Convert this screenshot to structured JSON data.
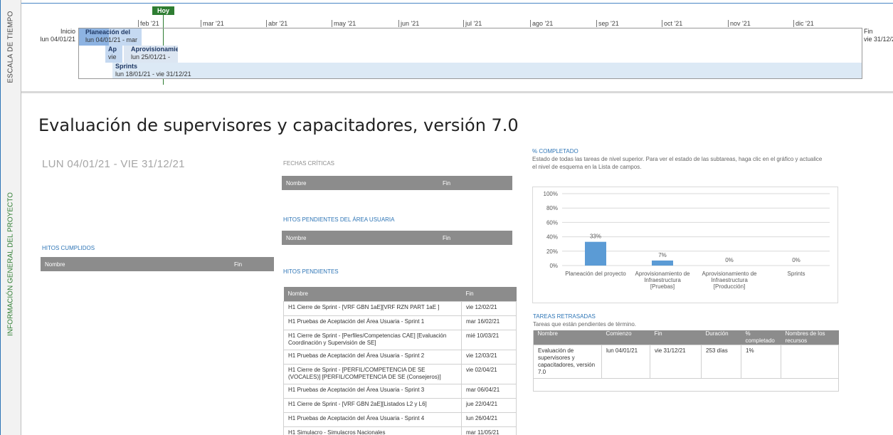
{
  "timeline": {
    "side_label": "ESCALA DE TIEMPO",
    "today_label": "Hoy",
    "months": [
      "feb '21",
      "mar '21",
      "abr '21",
      "may '21",
      "jun '21",
      "jul '21",
      "ago '21",
      "sep '21",
      "oct '21",
      "nov '21",
      "dic '21"
    ],
    "start": {
      "label": "Inicio",
      "date": "lun 04/01/21"
    },
    "end": {
      "label": "Fin",
      "date": "vie 31/12/2"
    },
    "tasks": [
      {
        "name": "Planeación del",
        "dates": "lun 04/01/21 - mar"
      },
      {
        "name": "Ap",
        "dates": "vie"
      },
      {
        "name": "Aprovisionamie",
        "dates": "lun 25/01/21 -"
      },
      {
        "name": "Sprints",
        "dates": "lun 18/01/21 - vie 31/12/21"
      }
    ]
  },
  "overview": {
    "side_label": "INFORMACIÓN GENERAL DEL PROYECTO",
    "title": "Evaluación de supervisores y capacitadores, versión 7.0",
    "date_range": "LUN 04/01/21 -  VIE 31/12/21"
  },
  "fechas_criticas": {
    "heading": "FECHAS CRÍTICAS",
    "columns": [
      "Nombre",
      "Fin"
    ]
  },
  "hitos_area_usuaria": {
    "heading": "HITOS PENDIENTES DEL ÁREA USUARIA",
    "columns": [
      "Nombre",
      "Fin"
    ]
  },
  "hitos_cumplidos": {
    "heading": "HITOS CUMPLIDOS",
    "columns": [
      "Nombre",
      "Fin"
    ]
  },
  "hitos_pendientes": {
    "heading": "HITOS PENDIENTES",
    "columns": [
      "Nombre",
      "Fin"
    ],
    "rows": [
      {
        "nombre": "H1 Cierre de Sprint - [VRF GBN 1aE][VRF RZN PART 1aE ]",
        "fin": "vie 12/02/21"
      },
      {
        "nombre": "H1 Pruebas de Aceptación del Área Usuaria - Sprint 1",
        "fin": "mar 16/02/21"
      },
      {
        "nombre": "H1 Cierre de Sprint - [Perfiles/Competencias CAE] [Evaluación Coordinación y Supervisión de SE]",
        "fin": "mié 10/03/21"
      },
      {
        "nombre": "H1 Pruebas de Aceptación del Área Usuaria - Sprint 2",
        "fin": "vie 12/03/21"
      },
      {
        "nombre": "H1 Cierre de Sprint - [PERFIL/COMPETENCIA DE SE (VOCALES)] [PERFIL/COMPETENCIA DE SE (Consejeros)]",
        "fin": "vie 02/04/21"
      },
      {
        "nombre": "H1 Pruebas de Aceptación del Área Usuaria - Sprint 3",
        "fin": "mar 06/04/21"
      },
      {
        "nombre": "H1 Cierre de Sprint - [VRF GBN 2aE][Listados L2 y L6]",
        "fin": "jue 22/04/21"
      },
      {
        "nombre": "H1 Pruebas de Aceptación del Área Usuaria - Sprint 4",
        "fin": "lun 26/04/21"
      },
      {
        "nombre": "H1 Simulacro - Simulacros Nacionales",
        "fin": "mar 11/05/21"
      }
    ]
  },
  "completado": {
    "heading": "% COMPLETADO",
    "description": "Estado de todas las tareas de nivel superior. Para ver el estado de las subtareas, haga clic en el gráfico y actualice el nivel de esquema en la Lista de campos."
  },
  "chart_data": {
    "type": "bar",
    "categories": [
      "Planeación del proyecto",
      "Aprovisionamiento de Infraestructura [Pruebas]",
      "Aprovisionamiento de Infraestructura [Producción]",
      "Sprints"
    ],
    "category_lines": [
      [
        "Planeación del proyecto"
      ],
      [
        "Aprovisionamiento de",
        "Infraestructura",
        "[Pruebas]"
      ],
      [
        "Aprovisionamiento de",
        "Infraestructura",
        "[Producción]"
      ],
      [
        "Sprints"
      ]
    ],
    "values": [
      33,
      7,
      0,
      0
    ],
    "data_labels": [
      "33%",
      "7%",
      "0%",
      "0%"
    ],
    "yticks": [
      "0%",
      "20%",
      "40%",
      "60%",
      "80%",
      "100%"
    ],
    "ylim": [
      0,
      100
    ],
    "grid": true,
    "bar_color": "#5b9bd5"
  },
  "tareas_retrasadas": {
    "heading": "TAREAS RETRASADAS",
    "description": "Tareas que están pendientes de término.",
    "columns": [
      "Nombre",
      "Comienzo",
      "Fin",
      "Duración",
      "% completado",
      "Nombres de los recursos"
    ],
    "rows": [
      {
        "nombre": "Evaluación de supervisores y capacitadores, versión 7.0",
        "comienzo": "lun 04/01/21",
        "fin": "vie 31/12/21",
        "duracion": "253 días",
        "completado": "1%",
        "recursos": ""
      }
    ]
  },
  "colors": {
    "accent_blue": "#2e75b6",
    "today_green": "#2e7d32",
    "table_header_gray": "#8c8c8c"
  }
}
